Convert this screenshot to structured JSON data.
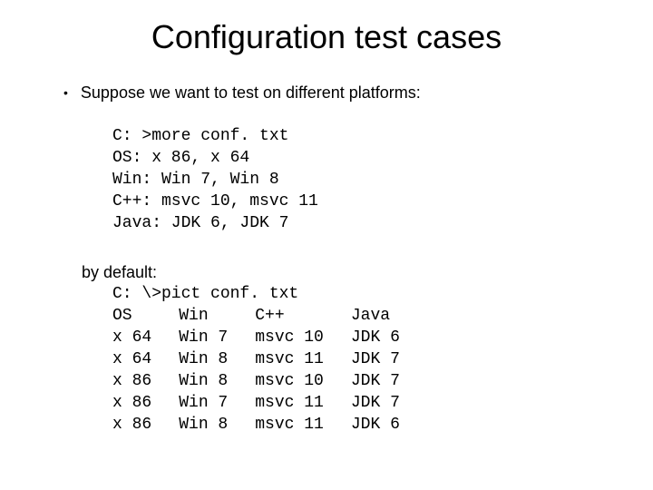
{
  "title": "Configuration test cases",
  "bullet": "Suppose we want to test on different platforms:",
  "conf": {
    "l1": "C: >more conf. txt",
    "l2": "OS: x 86, x 64",
    "l3": "Win: Win 7, Win 8",
    "l4": "C++: msvc 10, msvc 11",
    "l5": "Java: JDK 6, JDK 7"
  },
  "byDefault": "by default:",
  "pict": "C: \\>pict conf. txt",
  "headers": {
    "c0": "OS",
    "c1": "Win",
    "c2": "C++",
    "c3": "Java"
  },
  "rows": [
    {
      "c0": "x 64",
      "c1": "Win 7",
      "c2": "msvc 10",
      "c3": "JDK 6"
    },
    {
      "c0": "x 64",
      "c1": "Win 8",
      "c2": "msvc 11",
      "c3": "JDK 7"
    },
    {
      "c0": "x 86",
      "c1": "Win 8",
      "c2": "msvc 10",
      "c3": "JDK 7"
    },
    {
      "c0": "x 86",
      "c1": "Win 7",
      "c2": "msvc 11",
      "c3": "JDK 7"
    },
    {
      "c0": "x 86",
      "c1": "Win 8",
      "c2": "msvc 11",
      "c3": "JDK 6"
    }
  ]
}
